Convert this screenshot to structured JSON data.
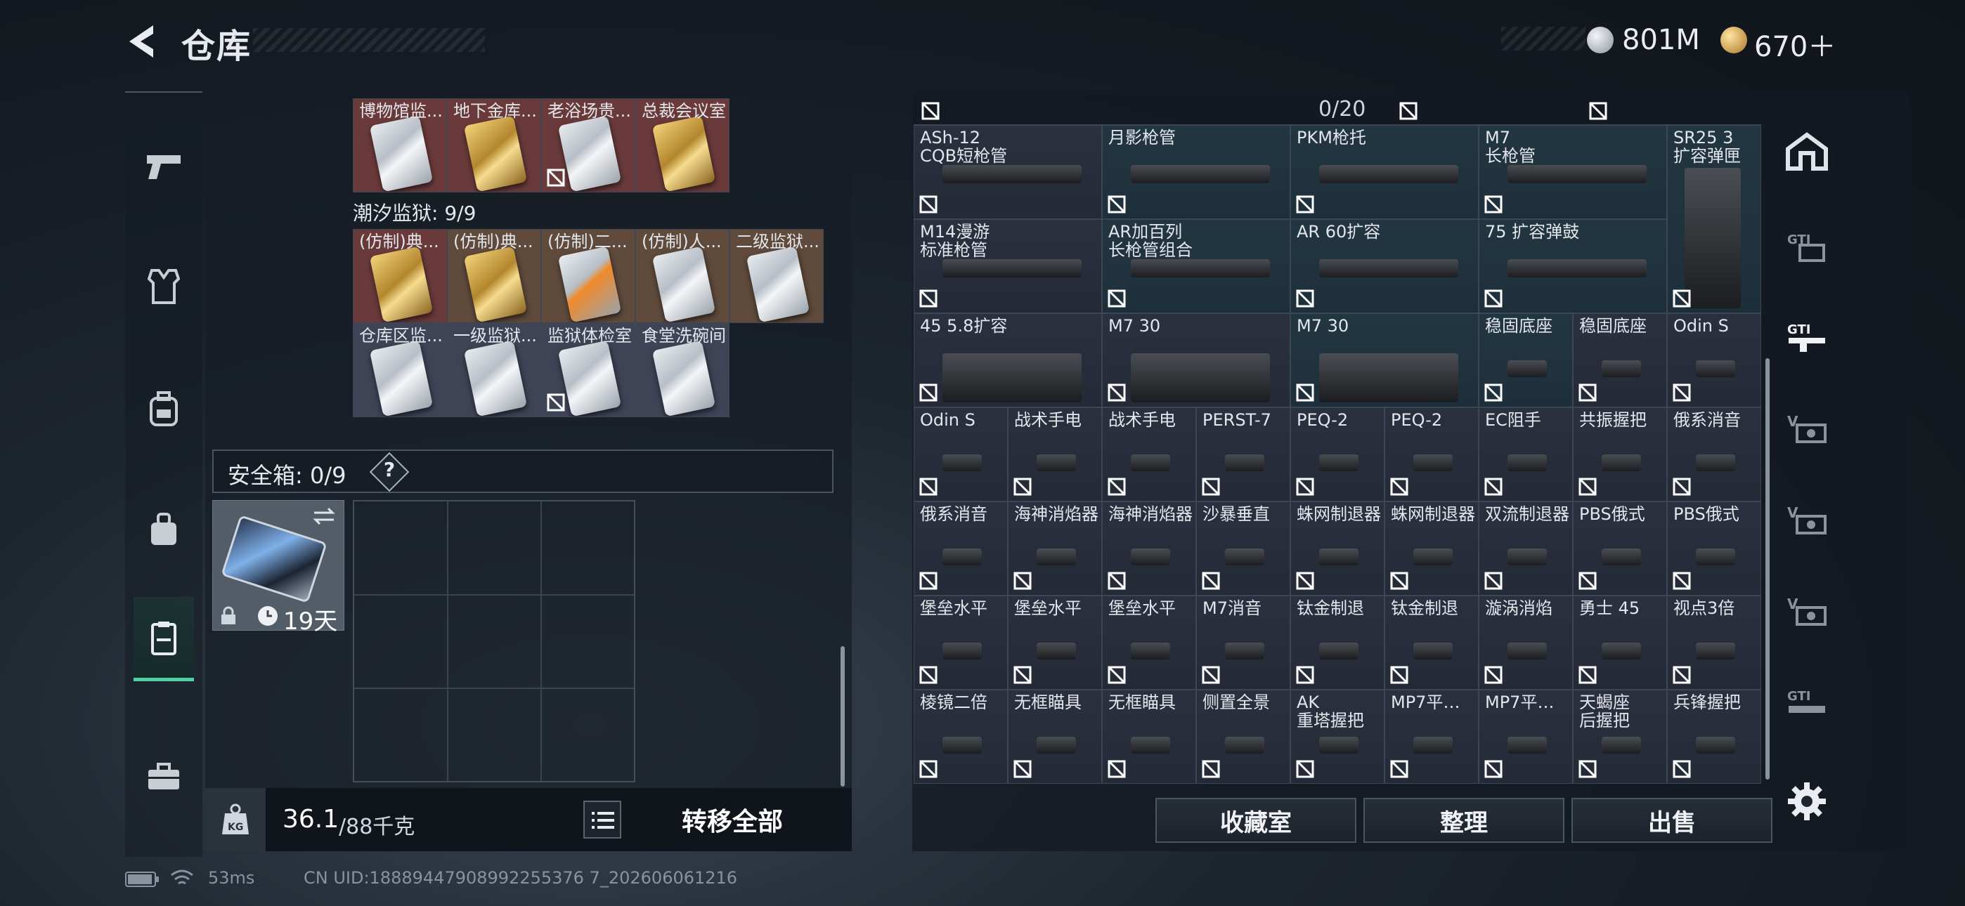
{
  "header": {
    "title": "仓库"
  },
  "currency": [
    {
      "icon": "silver-coin-icon",
      "value": "801M",
      "color": "#c9ced6"
    },
    {
      "icon": "gold-coin-icon",
      "value": "670＋",
      "color": "#e0b45a"
    }
  ],
  "left_nav": [
    "pistol-icon",
    "vest-icon",
    "backpack-icon",
    "bag-icon",
    "container-icon",
    "toolbox-icon"
  ],
  "inventory": {
    "top_row": [
      {
        "name": "博物馆监..."
      },
      {
        "name": "地下金库..."
      },
      {
        "name": "老浴场贵..."
      },
      {
        "name": "总裁会议室"
      }
    ],
    "section_title": "潮汐监狱: 9/9",
    "prison_row1": [
      {
        "name": "(仿制)典..."
      },
      {
        "name": "(仿制)典..."
      },
      {
        "name": "(仿制)二..."
      },
      {
        "name": "(仿制)人..."
      },
      {
        "name": "二级监狱..."
      }
    ],
    "prison_row2": [
      {
        "name": "仓库区监..."
      },
      {
        "name": "一级监狱..."
      },
      {
        "name": "监狱体检室"
      },
      {
        "name": "食堂洗碗间"
      }
    ]
  },
  "safe_box": {
    "label": "安全箱: 0/9",
    "help": "?",
    "timer": "19天"
  },
  "weight": {
    "current": "36.1",
    "max": "/88千克"
  },
  "transfer_label": "转移全部",
  "storage": {
    "count": "0/20",
    "rows": [
      [
        "ASh-12\nCQB短枪管",
        "月影枪管",
        "PKM枪托",
        "M7\n长枪管",
        "SR25 3\n扩容弹匣"
      ],
      [
        "M14漫游\n标准枪管",
        "AR加百列\n长枪管组合",
        "AR 60扩容",
        "75 扩容弹鼓",
        ""
      ],
      [
        "45 5.8扩容",
        "M7 30",
        "M7 30",
        "稳固底座",
        "稳固底座",
        "Odin S"
      ],
      [
        "Odin S",
        "战术手电",
        "战术手电",
        "PERST-7",
        "PEQ-2",
        "PEQ-2",
        "EC阻手",
        "共振握把",
        "俄系消音"
      ],
      [
        "俄系消音",
        "海神消焰器",
        "海神消焰器",
        "沙暴垂直",
        "蛛网制退器",
        "蛛网制退器",
        "双流制退器",
        "PBS俄式",
        "PBS俄式"
      ],
      [
        "堡垒水平",
        "堡垒水平",
        "堡垒水平",
        "M7消音",
        "钛金制退",
        "钛金制退",
        "漩涡消焰",
        "勇士 45",
        "视点3倍"
      ],
      [
        "棱镜二倍",
        "无框瞄具",
        "无框瞄具",
        "侧置全景",
        "AK\n重塔握把",
        "MP7平衡...",
        "MP7平衡...",
        "天蝎座\n后握把",
        "兵锋握把"
      ]
    ]
  },
  "actions": {
    "vault": "收藏室",
    "sort": "整理",
    "sell": "出售"
  },
  "right_nav": [
    "home-icon",
    "gti-attachment-icon",
    "gti-weapon-icon",
    "v-module-icon",
    "v-module-icon",
    "v-module-icon",
    "gti-module-icon"
  ],
  "status": {
    "ping": "53ms",
    "uid": "CN UID:18889447908992255376 7_202606061216"
  }
}
